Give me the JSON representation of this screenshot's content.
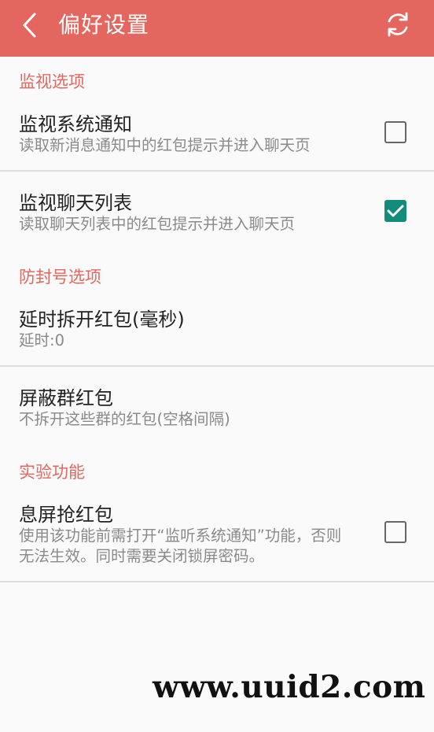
{
  "toolbar": {
    "title": "偏好设置",
    "back_icon": "chevron-left-icon",
    "refresh_icon": "refresh-icon",
    "color": "#e4675f"
  },
  "sections": {
    "monitor": {
      "category": "监视选项",
      "items": [
        {
          "title": "监视系统通知",
          "summary": "读取新消息通知中的红包提示并进入聊天页",
          "checked": false
        },
        {
          "title": "监视聊天列表",
          "summary": "读取聊天列表中的红包提示并进入聊天页",
          "checked": true
        }
      ]
    },
    "anti_ban": {
      "category": "防封号选项",
      "items": [
        {
          "title": "延时拆开红包(毫秒)",
          "summary": "延时:0"
        },
        {
          "title": "屏蔽群红包",
          "summary": "不拆开这些群的红包(空格间隔)"
        }
      ]
    },
    "experimental": {
      "category": "实验功能",
      "items": [
        {
          "title": "息屏抢红包",
          "summary_line1": "使用该功能前需打开“监听系统通知”功能，否则",
          "summary_line2": "无法生效。同时需要关闭锁屏密码。",
          "checked": false
        }
      ]
    }
  },
  "watermark": "www.uuid2.com",
  "colors": {
    "accent": "#e4675f",
    "checkbox_checked": "#138c7c",
    "background": "#fafafa"
  }
}
